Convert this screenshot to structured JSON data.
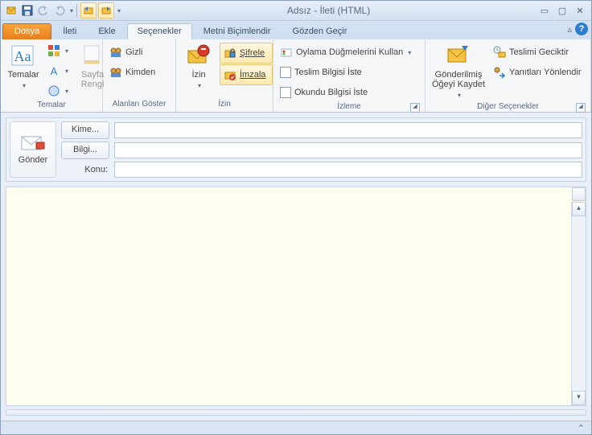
{
  "window": {
    "title": "Adsız  - İleti (HTML)"
  },
  "tabs": {
    "file": "Dosya",
    "ileti": "İleti",
    "ekle": "Ekle",
    "secenekler": "Seçenekler",
    "metni": "Metni Biçimlendir",
    "gozden": "Gözden Geçir"
  },
  "ribbon": {
    "temalar": {
      "label": "Temalar",
      "btn": "Temalar",
      "sayfa_rengi": "Sayfa\nRengi"
    },
    "alanlari": {
      "label": "Alanları Göster",
      "gizli": "Gizli",
      "kimden": "Kimden"
    },
    "izin": {
      "label": "İzin",
      "btn": "İzin",
      "sifrele": "Şifrele",
      "imzala": "İmzala"
    },
    "izleme": {
      "label": "İzleme",
      "oylama": "Oylama Düğmelerini Kullan",
      "teslim": "Teslim Bilgisi İste",
      "okundu": "Okundu Bilgisi İste"
    },
    "diger": {
      "label": "Diğer Seçenekler",
      "kaydet": "Gönderilmiş\nÖğeyi Kaydet",
      "geciktir": "Teslimi Geciktir",
      "yonlendir": "Yanıtları Yönlendir"
    }
  },
  "compose": {
    "gonder": "Gönder",
    "kime": "Kime...",
    "bilgi": "Bilgi...",
    "konu_label": "Konu:",
    "to_value": "",
    "cc_value": "",
    "subject_value": ""
  }
}
